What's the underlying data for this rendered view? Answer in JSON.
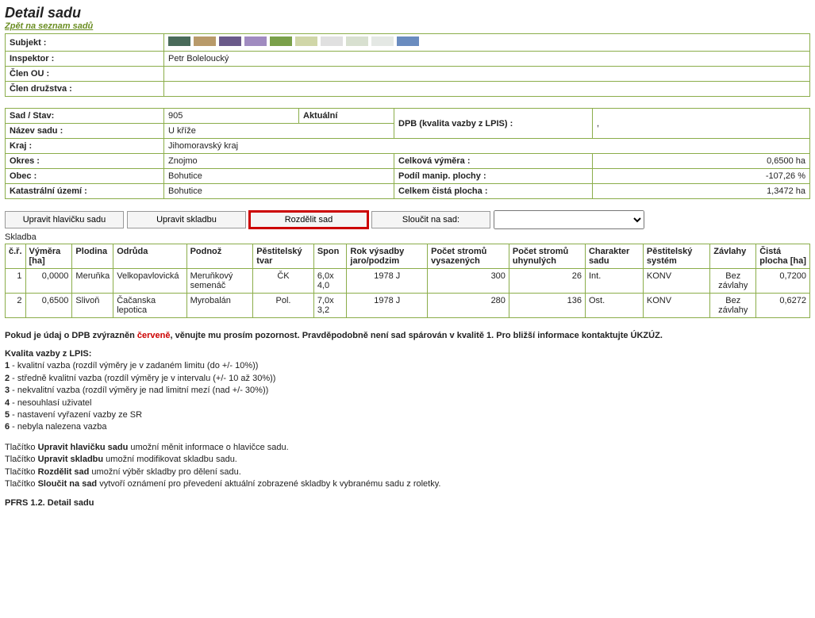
{
  "page": {
    "title": "Detail sadu",
    "backlink": "Zpět na seznam sadů"
  },
  "subject_block": {
    "subjekt_lbl": "Subjekt :",
    "inspektor_lbl": "Inspektor :",
    "inspektor_val": "Petr Boleloucký",
    "clen_ou_lbl": "Člen OU :",
    "clen_ou_val": "",
    "clen_druzstva_lbl": "Člen družstva :",
    "clen_druzstva_val": ""
  },
  "swatches": [
    "#4a6b5a",
    "#b89a6a",
    "#6a5a8a",
    "#a08bc0",
    "#7aa04a",
    "#d0d6a8",
    "#e0e0e0",
    "#d8e0d0",
    "#e4e8e4",
    "#6a8cbf"
  ],
  "detail": {
    "sad_stav_lbl": "Sad / Stav:",
    "sad_stav_val": "905",
    "sad_stav_extra": "Aktuální",
    "dpb_lbl": "DPB (kvalita vazby z LPIS) :",
    "dpb_val": ",",
    "nazev_lbl": "Název sadu :",
    "nazev_val": "U kříže",
    "kraj_lbl": "Kraj :",
    "kraj_val": "Jihomoravský kraj",
    "okres_lbl": "Okres :",
    "okres_val": "Znojmo",
    "celk_vymera_lbl": "Celková výměra :",
    "celk_vymera_val": "0,6500 ha",
    "obec_lbl": "Obec :",
    "obec_val": "Bohutice",
    "manip_lbl": "Podíl manip. plochy :",
    "manip_val": "-107,26 %",
    "kat_lbl": "Katastrální území :",
    "kat_val": "Bohutice",
    "cista_lbl": "Celkem čistá plocha :",
    "cista_val": "1,3472 ha"
  },
  "buttons": {
    "edit_header": "Upravit hlavičku sadu",
    "edit_comp": "Upravit skladbu",
    "split": "Rozdělit sad",
    "merge": "Sloučit na sad:"
  },
  "skladba_label": "Skladba",
  "composition": {
    "headers": [
      "č.ř.",
      "Výměra [ha]",
      "Plodina",
      "Odrůda",
      "Podnož",
      "Pěstitelský tvar",
      "Spon",
      "Rok výsadby jaro/podzim",
      "Počet stromů vysazených",
      "Počet stromů uhynulých",
      "Charakter sadu",
      "Pěstitelský systém",
      "Závlahy",
      "Čistá plocha [ha]"
    ],
    "rows": [
      {
        "n": "1",
        "vymera": "0,0000",
        "plodina": "Meruňka",
        "odruda": "Velkopavlovická",
        "podnoz": "Meruňkový semenáč",
        "tvar": "ČK",
        "spon": "6,0x 4,0",
        "rok": "1978 J",
        "vysazene": "300",
        "uhynule": "26",
        "char": "Int.",
        "system": "KONV",
        "zavlahy": "Bez závlahy",
        "cista": "0,7200"
      },
      {
        "n": "2",
        "vymera": "0,6500",
        "plodina": "Slivoň",
        "odruda": "Čačanska lepotica",
        "podnoz": "Myrobalán",
        "tvar": "Pol.",
        "spon": "7,0x 3,2",
        "rok": "1978 J",
        "vysazene": "280",
        "uhynule": "136",
        "char": "Ost.",
        "system": "KONV",
        "zavlahy": "Bez závlahy",
        "cista": "0,6272"
      }
    ]
  },
  "note": {
    "pre": "Pokud je údaj o DPB zvýrazněn ",
    "red": "červeně",
    "post": ", věnujte mu prosím pozornost. Pravděpodobně není sad spárován v kvalitě 1. Pro bližší informace kontaktujte ÚKZÚZ."
  },
  "legend": {
    "title": "Kvalita vazby z LPIS:",
    "items": [
      {
        "k": "1",
        "v": " - kvalitní vazba (rozdíl výměry je v zadaném limitu (do +/- 10%))"
      },
      {
        "k": "2",
        "v": " - středně kvalitní vazba (rozdíl výměry je v intervalu (+/- 10 až 30%))"
      },
      {
        "k": "3",
        "v": " - nekvalitní vazba (rozdíl výměry je nad limitní mezí (nad +/- 30%))"
      },
      {
        "k": "4",
        "v": " - nesouhlasí uživatel"
      },
      {
        "k": "5",
        "v": " - nastavení vyřazení vazby ze SR"
      },
      {
        "k": "6",
        "v": " - nebyla nalezena vazba"
      }
    ]
  },
  "hints": [
    {
      "pre": "Tlačítko ",
      "b": "Upravit hlavičku sadu",
      "post": " umožní měnit informace o hlavičce sadu."
    },
    {
      "pre": "Tlačítko ",
      "b": "Upravit skladbu",
      "post": " umožní modifikovat skladbu sadu."
    },
    {
      "pre": "Tlačítko ",
      "b": "Rozdělit sad",
      "post": " umožní výběr skladby pro dělení sadu."
    },
    {
      "pre": "Tlačítko ",
      "b": "Sloučit na sad",
      "post": " vytvoří oznámení pro převedení aktuální zobrazené skladby k vybranému sadu z roletky."
    }
  ],
  "caption": "PFRS 1.2. Detail sadu"
}
